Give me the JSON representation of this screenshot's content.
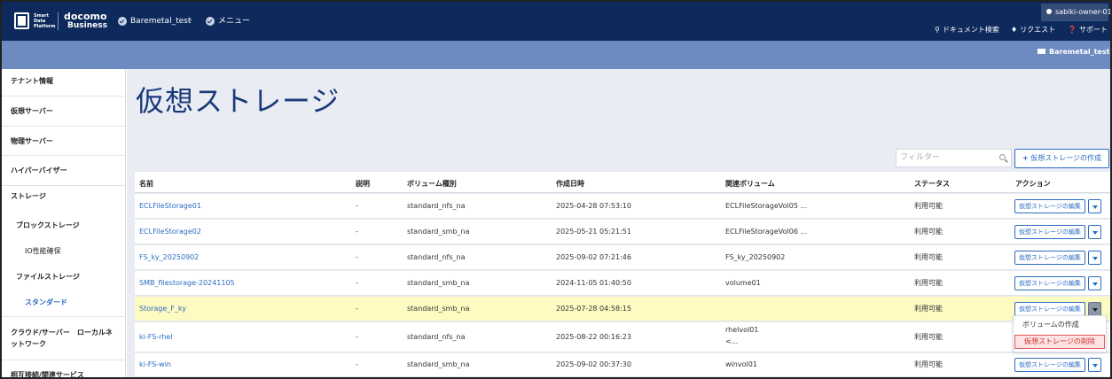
{
  "header": {
    "logo_lines": [
      "Smart",
      "Data",
      "Platform"
    ],
    "brand_top": "docomo",
    "brand_bottom": "Business",
    "breadcrumb": [
      "Baremetal_test",
      "メニュー"
    ],
    "user": "sabiki-owner-01",
    "links": [
      {
        "label": "ドキュメント検索",
        "icon": "search-icon"
      },
      {
        "label": "リクエスト",
        "icon": "bell-icon"
      },
      {
        "label": "サポート",
        "icon": "help-icon"
      }
    ],
    "tenant": "Baremetal_test"
  },
  "sidebar": {
    "items": [
      {
        "label": "テナント情報"
      },
      {
        "label": "仮想サーバー"
      },
      {
        "label": "物理サーバー"
      },
      {
        "label": "ハイパーバイザー"
      },
      {
        "label": "ストレージ"
      },
      {
        "label": "ブロックストレージ"
      },
      {
        "label": "IO性能確保"
      },
      {
        "label": "ファイルストレージ"
      },
      {
        "label": "スタンダード"
      },
      {
        "label": "クラウド/サーバー　ローカルネットワーク"
      },
      {
        "label": "相互接続/関連サービス"
      }
    ]
  },
  "main": {
    "title": "仮想ストレージ",
    "filter_placeholder": "フィルター",
    "create_button": "仮想ストレージの作成"
  },
  "table": {
    "columns": [
      "名前",
      "説明",
      "ボリューム種別",
      "作成日時",
      "関連ボリューム",
      "ステータス",
      "アクション"
    ],
    "edit_label": "仮想ストレージの編集",
    "rows": [
      {
        "name": "ECLFileStorage01",
        "desc": "-",
        "type": "standard_nfs_na",
        "created": "2025-04-28 07:53:10",
        "volume": "ECLFileStorageVol05 ...",
        "status": "利用可能"
      },
      {
        "name": "ECLFileStorage02",
        "desc": "-",
        "type": "standard_smb_na",
        "created": "2025-05-21 05:21:51",
        "volume": "ECLFileStorageVol06 ...",
        "status": "利用可能"
      },
      {
        "name": "FS_ky_20250902",
        "desc": "-",
        "type": "standard_nfs_na",
        "created": "2025-09-02 07:21:46",
        "volume": "FS_ky_20250902",
        "status": "利用可能"
      },
      {
        "name": "SMB_filestorage-20241105",
        "desc": "-",
        "type": "standard_smb_na",
        "created": "2024-11-05 01:40:50",
        "volume": "volume01",
        "status": "利用可能"
      },
      {
        "name": "Storage_F_ky",
        "desc": "-",
        "type": "standard_smb_na",
        "created": "2025-07-28 04:58:15",
        "volume": "",
        "status": "利用可能"
      },
      {
        "name": "ki-FS-rhel",
        "desc": "-",
        "type": "standard_nfs_na",
        "created": "2025-08-22 00:16:23",
        "volume": "rhelvol01",
        "volume2": "<...",
        "status": "利用可能"
      },
      {
        "name": "ki-FS-win",
        "desc": "-",
        "type": "standard_smb_na",
        "created": "2025-09-02 00:37:30",
        "volume": "winvol01",
        "status": "利用可能"
      }
    ]
  },
  "dropdown": {
    "items": [
      "ボリュームの作成",
      "仮想ストレージの削除"
    ]
  },
  "colors": {
    "header_bg": "#0e2a5c",
    "subheader_bg": "#6d8bc1",
    "link": "#2b6cc2",
    "highlight_row": "#fdfbc1",
    "danger": "#d12b2b"
  }
}
